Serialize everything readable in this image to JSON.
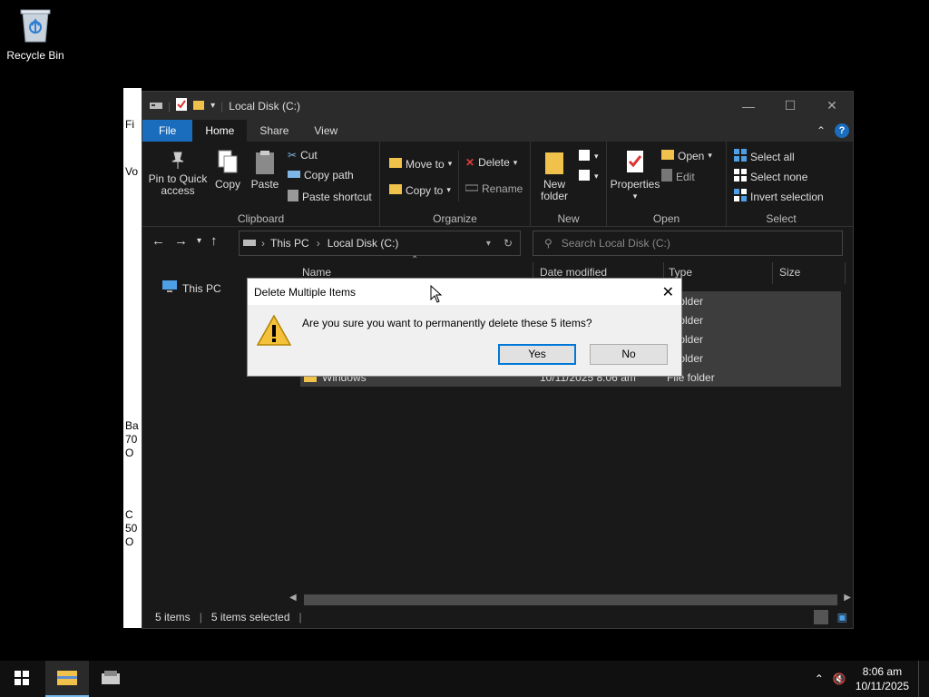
{
  "desktop": {
    "recycle_bin_label": "Recycle Bin"
  },
  "background_window": {
    "fragments": [
      "Fi",
      "Vo",
      "Ba",
      "70",
      "O",
      "C",
      "50",
      "O"
    ]
  },
  "explorer": {
    "title": "Local Disk (C:)",
    "tabs": {
      "file": "File",
      "home": "Home",
      "share": "Share",
      "view": "View"
    },
    "ribbon": {
      "clipboard": {
        "name": "Clipboard",
        "pin": "Pin to Quick access",
        "copy": "Copy",
        "paste": "Paste",
        "cut": "Cut",
        "copy_path": "Copy path",
        "paste_shortcut": "Paste shortcut"
      },
      "organize": {
        "name": "Organize",
        "move_to": "Move to",
        "copy_to": "Copy to",
        "delete": "Delete",
        "rename": "Rename"
      },
      "new": {
        "name": "New",
        "new_folder": "New folder"
      },
      "open": {
        "name": "Open",
        "properties": "Properties",
        "open": "Open",
        "edit": "Edit"
      },
      "select": {
        "name": "Select",
        "select_all": "Select all",
        "select_none": "Select none",
        "invert_selection": "Invert selection"
      }
    },
    "address": {
      "crumb1": "This PC",
      "crumb2": "Local Disk (C:)"
    },
    "search": {
      "placeholder": "Search Local Disk (C:)"
    },
    "nav_pane": {
      "this_pc": "This PC"
    },
    "columns": {
      "name": "Name",
      "date": "Date modified",
      "type": "Type",
      "size": "Size"
    },
    "rows": [
      {
        "name": "",
        "date": "",
        "type": "e folder"
      },
      {
        "name": "",
        "date": "",
        "type": "e folder"
      },
      {
        "name": "",
        "date": "",
        "type": "e folder"
      },
      {
        "name": "",
        "date": "",
        "type": "e folder"
      },
      {
        "name": "Windows",
        "date": "10/11/2025 8:06 am",
        "type": "File folder"
      }
    ],
    "status": {
      "items": "5 items",
      "selected": "5 items selected"
    }
  },
  "dialog": {
    "title": "Delete Multiple Items",
    "message": "Are you sure you want to permanently delete these 5 items?",
    "yes": "Yes",
    "no": "No"
  },
  "taskbar": {
    "time": "8:06 am",
    "date": "10/11/2025"
  },
  "colors": {
    "accent": "#1a6dbd",
    "folder": "#f0c14b",
    "row_selected": "#3d3d3d"
  }
}
